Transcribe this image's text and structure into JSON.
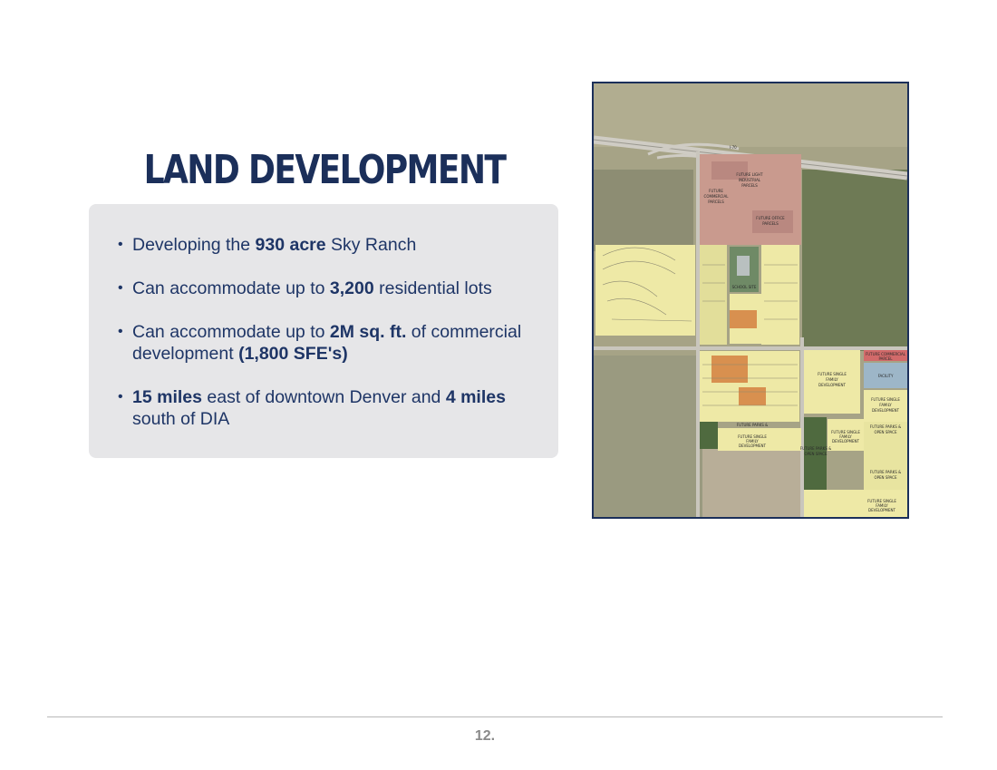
{
  "slide": {
    "title": "LAND DEVELOPMENT",
    "page_number": "12."
  },
  "bullets": [
    {
      "pre": "Developing the ",
      "bold": "930 acre",
      "post": " Sky Ranch"
    },
    {
      "pre": "Can accommodate up to ",
      "bold": "3,200",
      "post": " residential lots"
    },
    {
      "pre": "Can accommodate up to ",
      "bold": "2M sq. ft.",
      "post": " of commercial development ",
      "bold2": "(1,800 SFE's)",
      "post2": ""
    },
    {
      "pre": "",
      "bold": "15 miles",
      "post": " east of downtown Denver and ",
      "bold2": "4 miles",
      "post2": " south of DIA"
    }
  ],
  "map": {
    "highway_label": "I-70",
    "labels": {
      "light_industrial": [
        "FUTURE LIGHT",
        "INDUSTRIAL",
        "PARCELS"
      ],
      "commercial": [
        "FUTURE",
        "COMMERCIAL",
        "PARCELS"
      ],
      "office": [
        "FUTURE OFFICE",
        "PARCELS"
      ],
      "school": "SCHOOL SITE",
      "sf_east_1": [
        "FUTURE SINGLE",
        "FAMILY",
        "DEVELOPMENT"
      ],
      "sf_east_2": [
        "FUTURE SINGLE",
        "FAMILY",
        "DEVELOPMENT"
      ],
      "sf_south_center": [
        "FUTURE SINGLE",
        "FAMILY",
        "DEVELOPMENT"
      ],
      "sf_south_mid": [
        "FUTURE SINGLE",
        "FAMILY",
        "DEVELOPMENT"
      ],
      "sf_south_east": [
        "FUTURE SINGLE",
        "FAMILY",
        "DEVELOPMENT"
      ],
      "parks_center": [
        "FUTURE PARKS &",
        "OPEN SPACE"
      ],
      "parks_east": [
        "FUTURE PARKS &",
        "OPEN SPACE"
      ],
      "parks_south": [
        "FUTURE PARKS &",
        "OPEN SPACE"
      ],
      "parks_se": [
        "FUTURE PARKS &",
        "OPEN SPACE"
      ],
      "commercial_east": [
        "FUTURE COMMERCIAL",
        "PARCEL"
      ],
      "facility": [
        "FACILITY"
      ]
    },
    "colors": {
      "field": "#a9a689",
      "residential": "#eee9a6",
      "commercial": "#c99a8e",
      "orange_lots": "#d8904f",
      "green_space": "#4f6a3f",
      "road": "#c9c6bd"
    }
  }
}
